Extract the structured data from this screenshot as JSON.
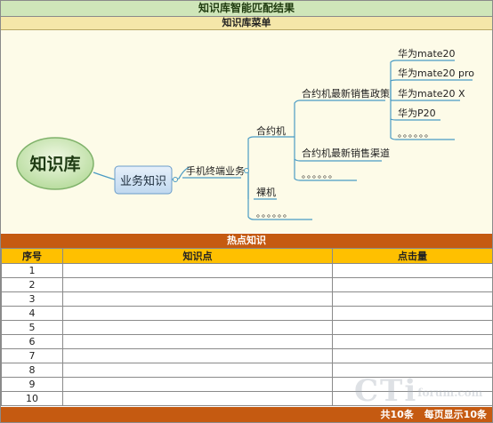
{
  "title": "知识库智能匹配结果",
  "menu_title": "知识库菜单",
  "mindmap": {
    "root": "知识库",
    "level1": "业务知识",
    "level2": "手机终端业务",
    "level3": [
      "合约机",
      "裸机"
    ],
    "contract_children": [
      "合约机最新销售政策",
      "合约机最新销售渠道"
    ],
    "policy_children": [
      "华为mate20",
      "华为mate20 pro",
      "华为mate20 X",
      "华为P20"
    ],
    "ellipsis": "。。。。。。"
  },
  "hot_title": "热点知识",
  "table": {
    "headers": [
      "序号",
      "知识点",
      "点击量"
    ],
    "rows": [
      {
        "no": "1",
        "point": "",
        "clicks": ""
      },
      {
        "no": "2",
        "point": "",
        "clicks": ""
      },
      {
        "no": "3",
        "point": "",
        "clicks": ""
      },
      {
        "no": "4",
        "point": "",
        "clicks": ""
      },
      {
        "no": "5",
        "point": "",
        "clicks": ""
      },
      {
        "no": "6",
        "point": "",
        "clicks": ""
      },
      {
        "no": "7",
        "point": "",
        "clicks": ""
      },
      {
        "no": "8",
        "point": "",
        "clicks": ""
      },
      {
        "no": "9",
        "point": "",
        "clicks": ""
      },
      {
        "no": "10",
        "point": "",
        "clicks": ""
      }
    ]
  },
  "footer": {
    "total": "共10条",
    "per_page": "每页显示10条"
  },
  "watermark": {
    "main": "CTi",
    "sub": "forum.com"
  },
  "colors": {
    "title_bg": "#cfe6b9",
    "menu_bg": "#f5e7a9",
    "hot_bg": "#c55a11",
    "header_bg": "#ffc000",
    "branch": "#4a9bc4"
  }
}
